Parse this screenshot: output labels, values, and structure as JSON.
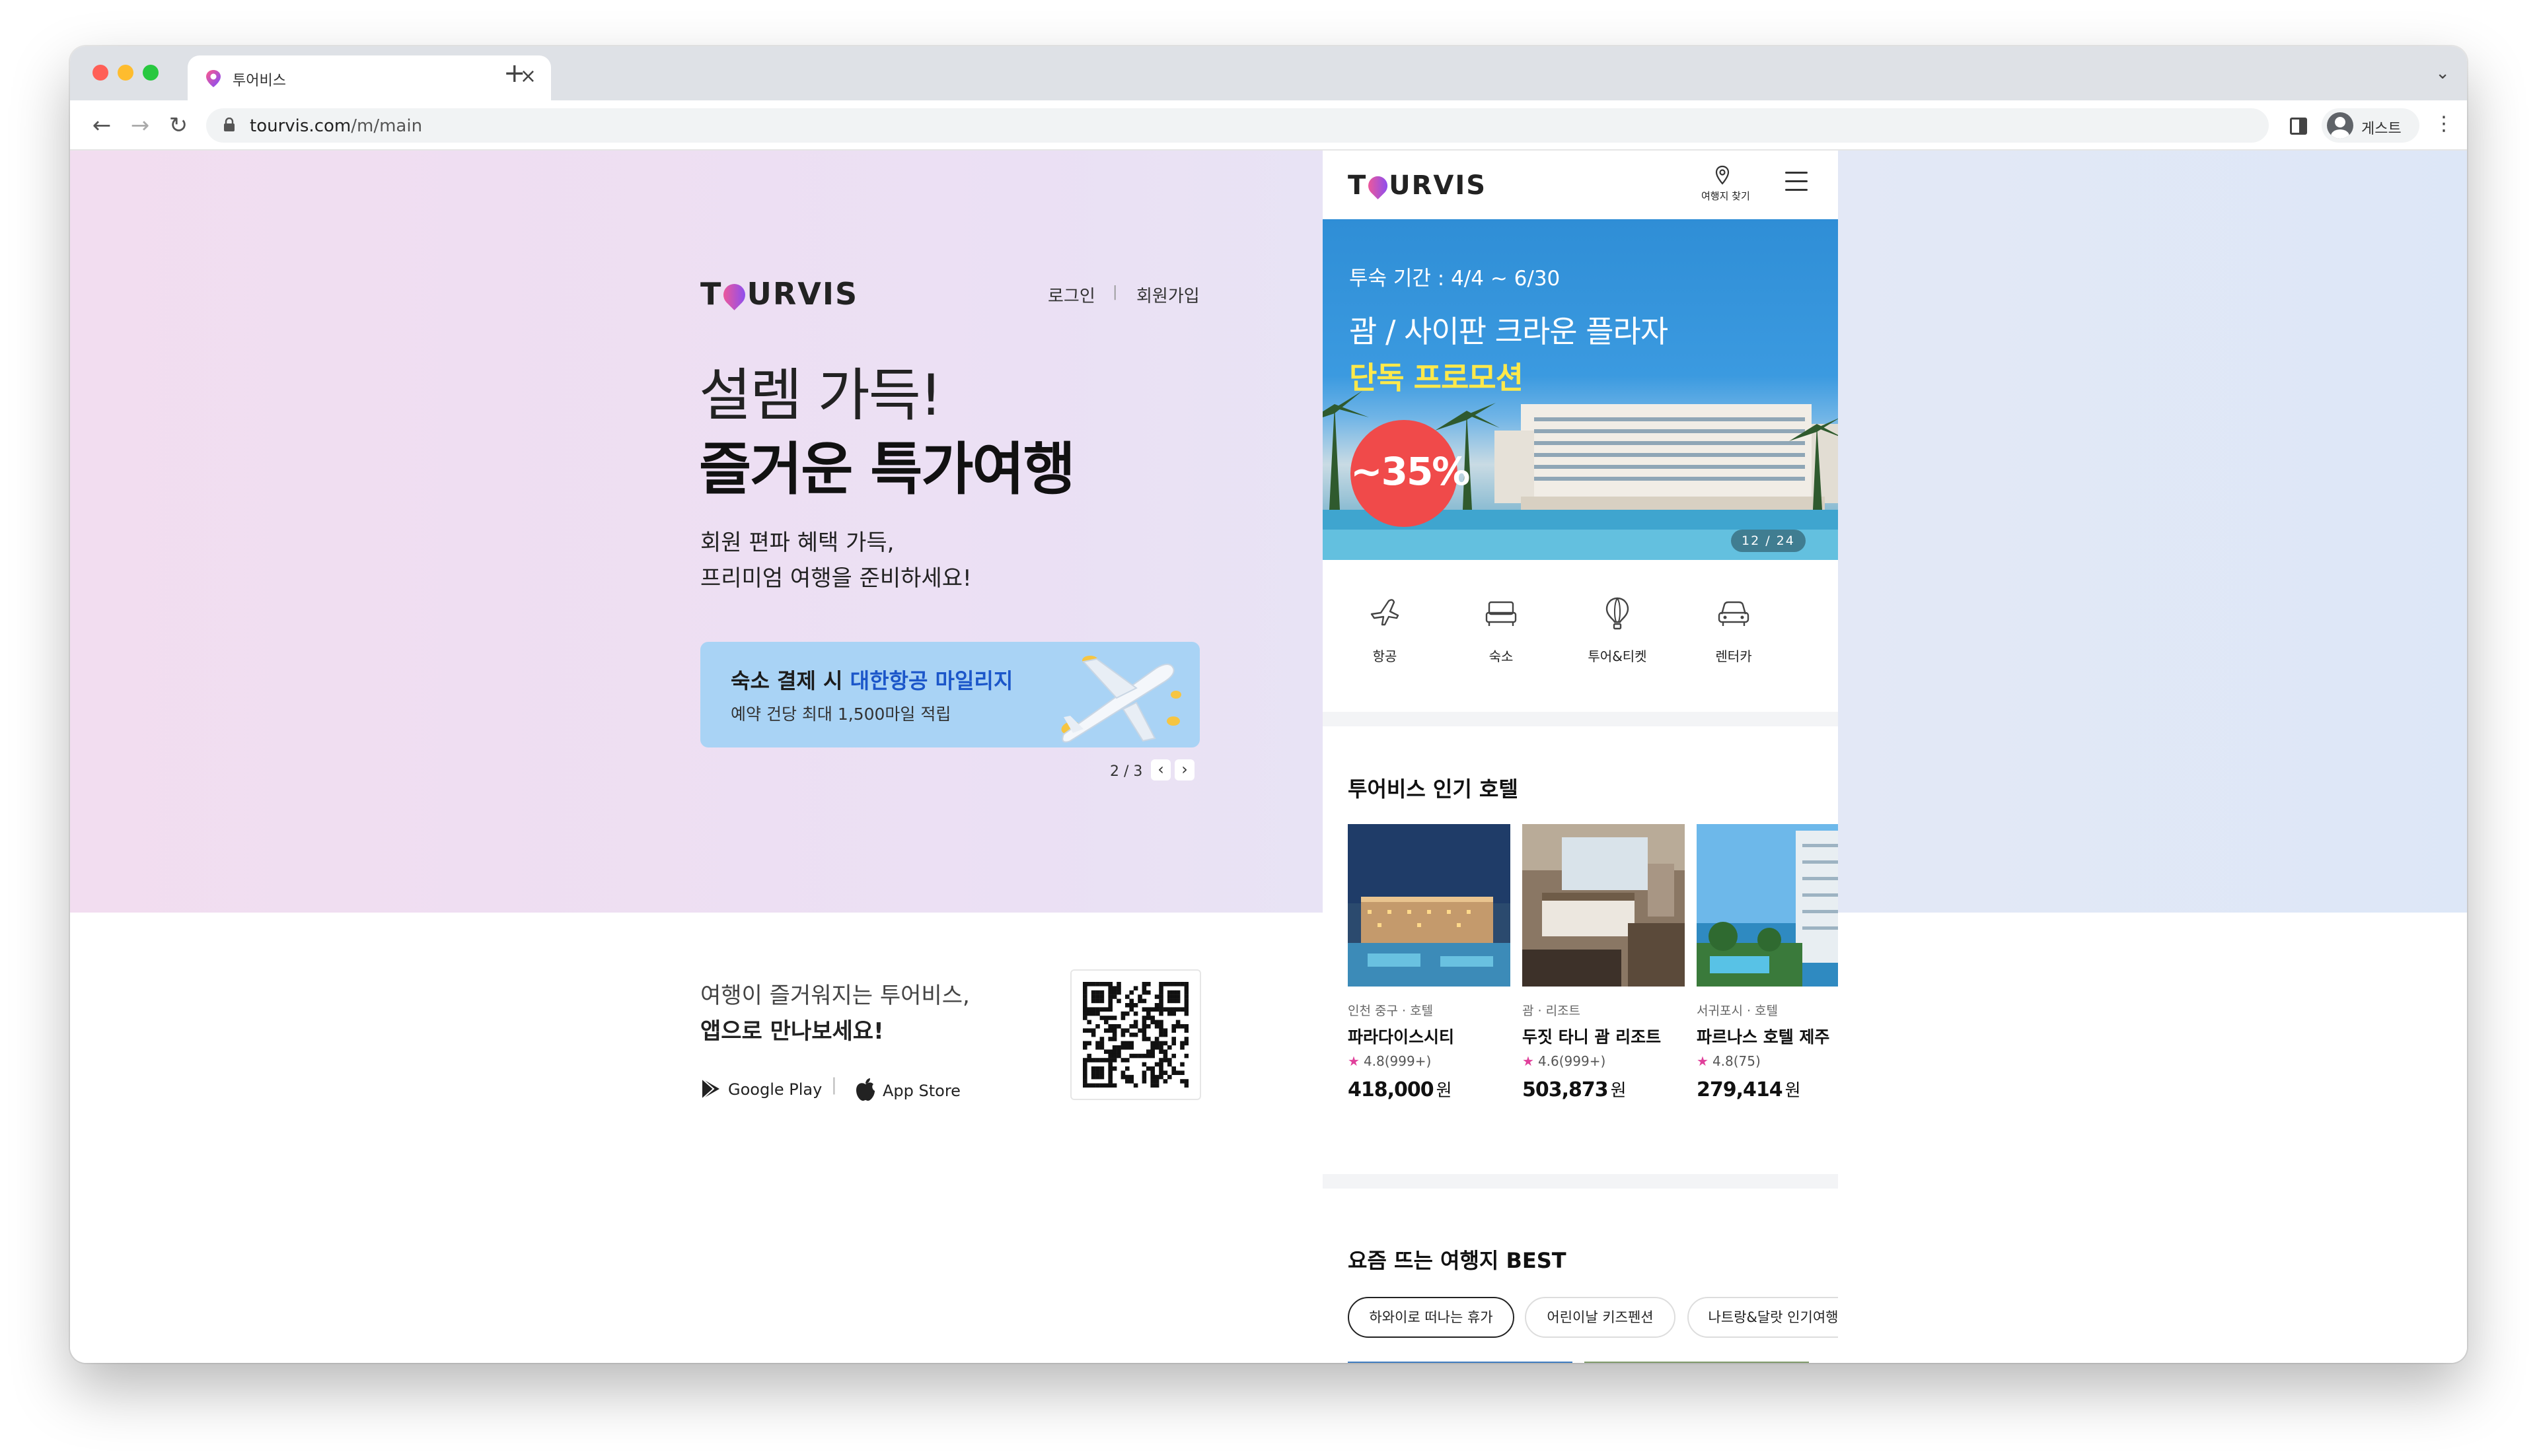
{
  "browser": {
    "tab_title": "투어비스",
    "tab_close": "×",
    "new_tab": "+",
    "tabs_menu": "⌄",
    "nav_back": "←",
    "nav_forward": "→",
    "nav_reload": "↻",
    "url_host": "tourvis.com",
    "url_path": "/m/main",
    "profile_label": "게스트",
    "menu": "⋮",
    "colors": {
      "tabbar": "#dee1e6",
      "close": "#ff5f57",
      "minimize": "#febc2e",
      "zoom": "#28c840"
    }
  },
  "landing": {
    "logo_pre": "T",
    "logo_post": "URVIS",
    "login": "로그인",
    "separator": "|",
    "signup": "회원가입",
    "headline_light": "설렘 가득!",
    "headline_bold": "즐거운 특가여행",
    "sub_line1": "회원 편파 혜택 가득,",
    "sub_line2": "프리미엄 여행을 준비하세요!",
    "banner": {
      "title_pre": "숙소 결제 시 ",
      "title_highlight": "대한항공 마일리지",
      "subtitle": "예약 건당 최대 1,500마일 적립"
    },
    "pager": "2 / 3",
    "prev": "‹",
    "next": "›",
    "app_line1": "여행이 즐거워지는 투어비스,",
    "app_line2": "앱으로 만나보세요!",
    "google_play": "Google Play",
    "store_sep": "|",
    "app_store": "App Store"
  },
  "mobile": {
    "logo_pre": "T",
    "logo_post": "URVIS",
    "find_label": "여행지 찾기",
    "hero": {
      "period": "투숙 기간 : 4/4 ~ 6/30",
      "title": "괌 / 사이판 크라운 플라자",
      "promo": "단독 프로모션",
      "discount": "~35%",
      "counter": "12 / 24"
    },
    "categories": [
      {
        "label": "항공",
        "icon": "airplane-icon"
      },
      {
        "label": "숙소",
        "icon": "bed-icon"
      },
      {
        "label": "투어&티켓",
        "icon": "balloon-icon"
      },
      {
        "label": "렌터카",
        "icon": "car-icon"
      }
    ],
    "popular_title": "투어비스 인기 호텔",
    "hotels": [
      {
        "location": "인천 중구 · 호텔",
        "name": "파라다이스시티",
        "rating": "4.8(999+)",
        "price": "418,000",
        "unit": "원"
      },
      {
        "location": "괌 · 리조트",
        "name": "두짓 타니 괌 리조트",
        "rating": "4.6(999+)",
        "price": "503,873",
        "unit": "원"
      },
      {
        "location": "서귀포시 · 호텔",
        "name": "파르나스 호텔 제주",
        "rating": "4.8(75)",
        "price": "279,414",
        "unit": "원"
      }
    ],
    "star": "★",
    "best_title": "요즘 뜨는 여행지 BEST",
    "chips": [
      "하와이로 떠나는 휴가",
      "어린이날 키즈펜션",
      "나트랑&달랏 인기여행"
    ]
  }
}
